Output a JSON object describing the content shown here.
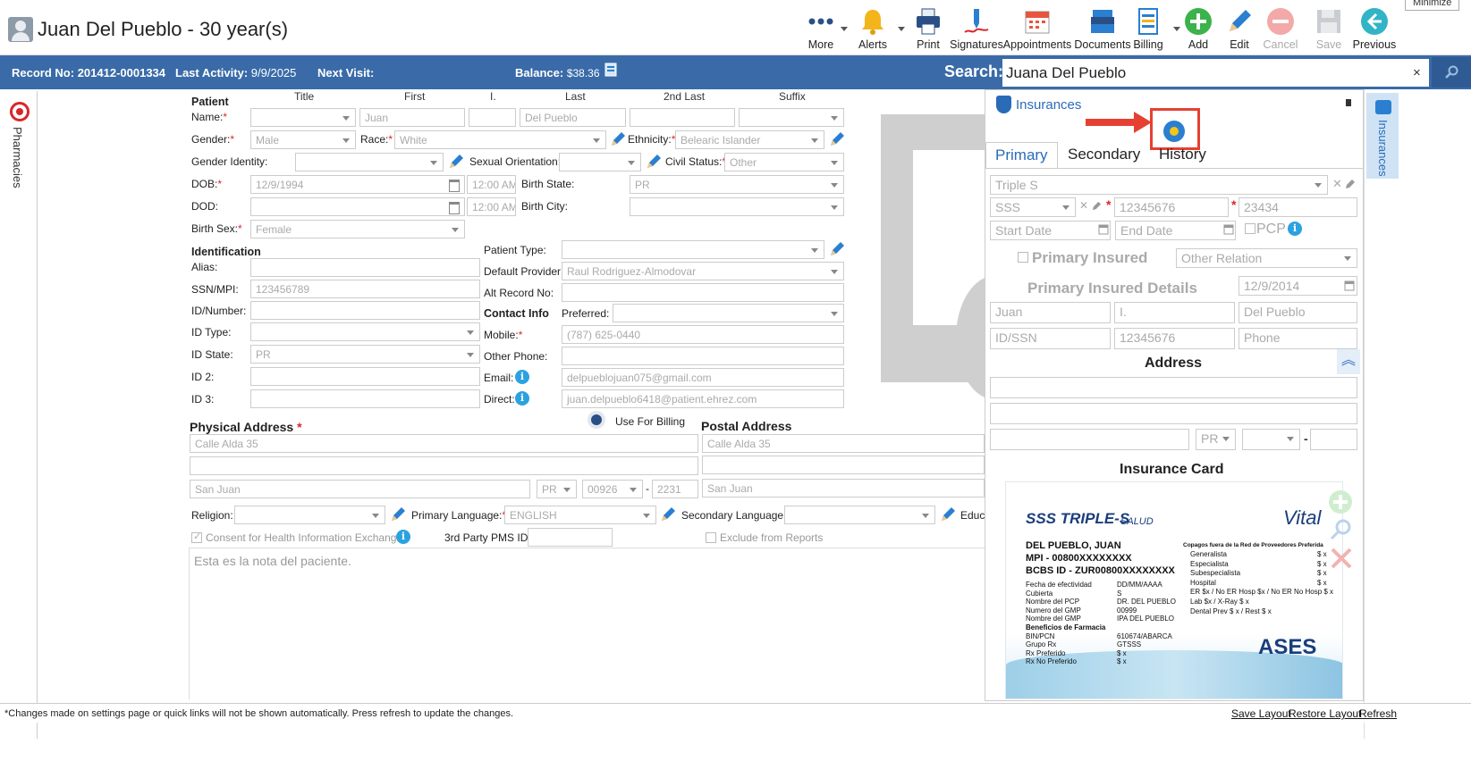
{
  "header": {
    "patient_title": "Juan Del Pueblo - 30 year(s)",
    "minimize_tooltip": "Minimize",
    "toolbar": [
      {
        "label": "More",
        "icon": "more-dots-icon"
      },
      {
        "label": "Alerts",
        "icon": "bell-icon"
      },
      {
        "label": "Print",
        "icon": "printer-icon"
      },
      {
        "label": "Signatures",
        "icon": "pen-signature-icon"
      },
      {
        "label": "Appointments",
        "icon": "calendar-icon"
      },
      {
        "label": "Documents",
        "icon": "documents-stack-icon"
      },
      {
        "label": "Billing",
        "icon": "billing-document-icon"
      },
      {
        "label": "Add",
        "icon": "plus-circle-icon"
      },
      {
        "label": "Edit",
        "icon": "pencil-icon"
      },
      {
        "label": "Cancel",
        "icon": "cancel-circle-icon"
      },
      {
        "label": "Save",
        "icon": "floppy-disk-icon"
      },
      {
        "label": "Previous",
        "icon": "arrow-left-circle-icon"
      }
    ]
  },
  "infobar": {
    "record_label": "Record No:",
    "record_value": "201412-0001334",
    "activity_label": "Last Activity:",
    "activity_value": "9/9/2025",
    "next_visit_label": "Next Visit:",
    "balance_label": "Balance:",
    "balance_value": "$38.36",
    "search_label": "Search:",
    "search_value": "Juana Del Pueblo",
    "search_clear": "×"
  },
  "left_rail": {
    "label": "Pharmacies"
  },
  "form": {
    "patient_section": "Patient",
    "columns": {
      "title": "Title",
      "first": "First",
      "initial": "I.",
      "last": "Last",
      "second_last": "2nd Last",
      "suffix": "Suffix"
    },
    "labels": {
      "name": "Name:",
      "gender": "Gender:",
      "race": "Race:",
      "ethnicity": "Ethnicity:",
      "gender_identity": "Gender Identity:",
      "sexual_orientation": "Sexual Orientation:",
      "civil_status": "Civil Status:",
      "dob": "DOB:",
      "birth_state": "Birth State:",
      "dod": "DOD:",
      "birth_city": "Birth City:",
      "birth_sex": "Birth Sex:",
      "identification": "Identification",
      "patient_type": "Patient Type:",
      "alias": "Alias:",
      "default_provider": "Default Provider:",
      "ssn": "SSN/MPI:",
      "alt_record": "Alt Record No:",
      "id_number": "ID/Number:",
      "contact_info": "Contact Info",
      "preferred": "Preferred:",
      "id_type": "ID Type:",
      "mobile": "Mobile:",
      "id_state": "ID State:",
      "other_phone": "Other Phone:",
      "id2": "ID 2:",
      "email": "Email:",
      "id3": "ID 3:",
      "direct": "Direct:",
      "physical_address": "Physical Address",
      "use_for_billing": "Use For Billing",
      "postal_address": "Postal Address",
      "religion": "Religion:",
      "primary_language": "Primary Language:",
      "secondary_language": "Secondary Language:",
      "education": "Educa",
      "consent": "Consent for Health Information Exchange",
      "third_party": "3rd Party PMS ID:",
      "exclude": "Exclude from Reports"
    },
    "values": {
      "first": "Juan",
      "last": "Del Pueblo",
      "gender": "Male",
      "race": "White",
      "ethnicity": "Belearic Islander",
      "civil_status": "Other",
      "dob": "12/9/1994",
      "dob_time": "12:00 AM",
      "birth_state": "PR",
      "dod_time": "12:00 AM",
      "birth_sex": "Female",
      "default_provider": "Raul Rodriguez-Almodovar",
      "ssn": "123456789",
      "id_state": "PR",
      "mobile": "(787) 625-0440",
      "email": "delpueblojuan075@gmail.com",
      "direct": "juan.delpueblo6418@patient.ehrez.com",
      "phys_line1": "Calle Alda 35",
      "phys_city": "San Juan",
      "phys_state": "PR",
      "phys_zip": "00926",
      "phys_zip4": "2231",
      "postal_line1": "Calle Alda 35",
      "postal_city": "San Juan",
      "primary_language": "ENGLISH",
      "notes": "Esta es la nota del paciente.",
      "zip_dash": "-"
    }
  },
  "insurance": {
    "title": "Insurances",
    "tabs": [
      "Primary",
      "Secondary",
      "History"
    ],
    "plan": "Triple S",
    "plan_type": "SSS",
    "policy": "12345676",
    "group": "23434",
    "start_placeholder": "Start Date",
    "end_placeholder": "End Date",
    "pcp": "PCP",
    "primary_insured": "Primary Insured",
    "other_relation": "Other Relation",
    "details_title": "Primary Insured Details",
    "insured_dob": "12/9/2014",
    "insured_first": "Juan",
    "insured_initial": "I.",
    "insured_last": "Del Pueblo",
    "insured_id_placeholder": "ID/SSN",
    "insured_id": "12345676",
    "phone_placeholder": "Phone",
    "address_title": "Address",
    "addr_state": "PR",
    "card_title": "Insurance Card",
    "card": {
      "brand": "SSS TRIPLE-S",
      "brand_sub": "SALUD",
      "vital": "Vital",
      "name": "DEL PUEBLO, JUAN",
      "mpi": "MPI - 00800XXXXXXXX",
      "bcbs": "BCBS ID - ZUR00800XXXXXXXX",
      "rows_left": [
        [
          "Fecha de efectividad",
          "DD/MM/AAAA"
        ],
        [
          "Cubierta",
          "S"
        ],
        [
          "Nombre del PCP",
          "DR. DEL PUEBLO"
        ],
        [
          "Numero del GMP",
          "00999"
        ],
        [
          "Nombre del GMP",
          "IPA DEL PUEBLO"
        ],
        [
          "Beneficios de Farmacia",
          ""
        ],
        [
          "BIN/PCN",
          "610674/ABARCA"
        ],
        [
          "Grupo Rx",
          "GTSSS"
        ],
        [
          "Rx Preferido",
          "$ x"
        ],
        [
          "Rx No Preferido",
          "$ x"
        ]
      ],
      "copay_title": "Copagos fuera de la Red de Proveedores Preferida",
      "rows_right": [
        [
          "Generalista",
          "$ x"
        ],
        [
          "Especialista",
          "$ x"
        ],
        [
          "Subespecialista",
          "$ x"
        ],
        [
          "Hospital",
          "$ x"
        ],
        [
          "ER $x / No ER Hosp $x / No ER No Hosp $ x",
          ""
        ],
        [
          "Lab $x / X-Ray $ x",
          ""
        ],
        [
          "Dental Prev $ x / Rest $ x",
          ""
        ]
      ],
      "ases": "ASES"
    }
  },
  "right_rail": {
    "label": "Insurances"
  },
  "footer": {
    "note": "*Changes made on settings page or quick links will not be shown automatically. Press refresh to update the changes.",
    "save_layout": "Save Layout",
    "restore_layout": "Restore Layout",
    "refresh": "Refresh"
  },
  "colors": {
    "brand_blue": "#3a6ba8",
    "link_blue": "#2a6bb8",
    "required_red": "#d9262c",
    "highlight_red": "#e64032"
  }
}
